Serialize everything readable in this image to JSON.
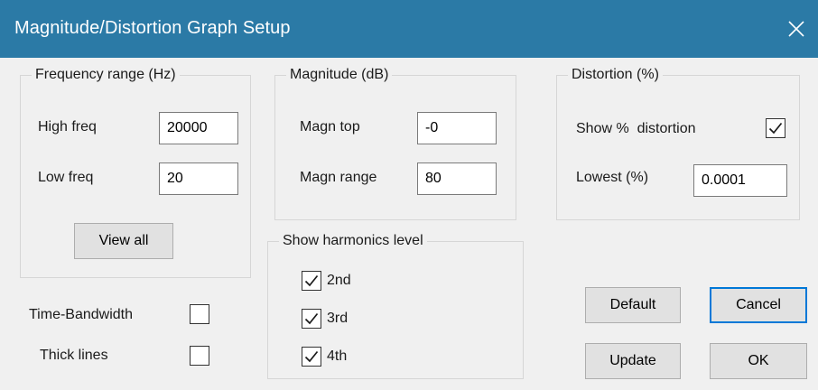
{
  "window": {
    "title": "Magnitude/Distortion Graph Setup",
    "close_icon": "close-icon"
  },
  "frequency": {
    "legend": "Frequency range (Hz)",
    "high_label": "High freq",
    "high_value": "20000",
    "low_label": "Low freq",
    "low_value": "20",
    "view_all_label": "View all"
  },
  "magnitude": {
    "legend": "Magnitude (dB)",
    "top_label": "Magn top",
    "top_value": "-0",
    "range_label": "Magn range",
    "range_value": "80"
  },
  "distortion": {
    "legend": "Distortion (%)",
    "show_label": "Show %  distortion",
    "show_checked": true,
    "lowest_label": "Lowest (%)",
    "lowest_value": "0.0001"
  },
  "harmonics": {
    "legend": "Show harmonics level",
    "items": [
      {
        "label": "2nd",
        "checked": true
      },
      {
        "label": "3rd",
        "checked": true
      },
      {
        "label": "4th",
        "checked": true
      }
    ]
  },
  "options": {
    "time_bandwidth_label": "Time-Bandwidth",
    "time_bandwidth_checked": false,
    "thick_lines_label": "Thick lines",
    "thick_lines_checked": false
  },
  "buttons": {
    "default": "Default",
    "cancel": "Cancel",
    "update": "Update",
    "ok": "OK"
  }
}
